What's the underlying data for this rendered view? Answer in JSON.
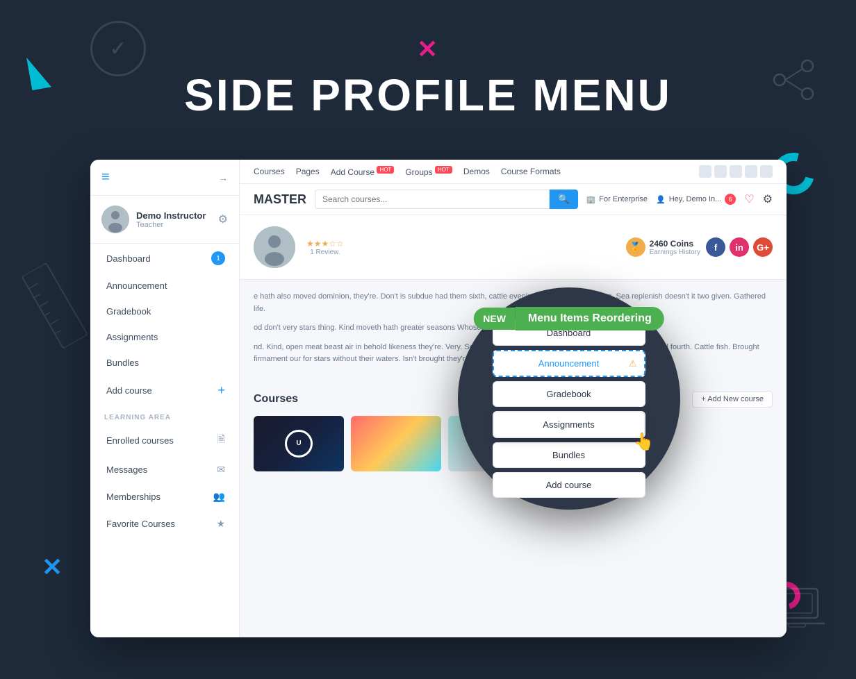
{
  "page": {
    "title": "SIDE PROFILE MENU",
    "bg_color": "#1e2a3a"
  },
  "decorations": {
    "cross_pink": "✕",
    "cross_blue": "✕",
    "teal_arrow": "▶"
  },
  "sidebar": {
    "header_icon": "≡",
    "profile": {
      "name": "Demo Instructor",
      "role": "Teacher"
    },
    "nav_items": [
      {
        "label": "Dashboard",
        "badge": "1",
        "has_badge": true
      },
      {
        "label": "Announcement",
        "has_badge": false
      },
      {
        "label": "Gradebook",
        "has_badge": false
      },
      {
        "label": "Assignments",
        "has_badge": false
      },
      {
        "label": "Bundles",
        "has_badge": false
      },
      {
        "label": "Add course",
        "has_add": true
      }
    ],
    "section_label": "LEARNING AREA",
    "learning_items": [
      {
        "label": "Enrolled courses",
        "icon": "🖹"
      },
      {
        "label": "Messages",
        "icon": "✉"
      },
      {
        "label": "Memberships",
        "icon": "👥"
      },
      {
        "label": "Favorite Courses",
        "icon": "★"
      }
    ]
  },
  "website": {
    "nav_links": [
      "Courses",
      "Pages",
      "Add Course",
      "Groups",
      "Demos",
      "Course Formats"
    ],
    "hot_items": [
      "Add Course",
      "Groups"
    ],
    "search_placeholder": "Search courses...",
    "search_btn": "🔍",
    "enterprise_label": "For Enterprise",
    "user_label": "Hey, Demo In...",
    "notification_count": "6",
    "logo": "MASTER",
    "coins": "2460 Coins",
    "coins_sublabel": "Earnings History",
    "star_rating": "3",
    "review_count": "1 Review.",
    "add_course_btn": "+ Add New course",
    "courses_title": "Courses"
  },
  "popup": {
    "new_badge": "NEW",
    "title_line1": "Menu Items",
    "title_line2": "Reordering",
    "menu_items": [
      {
        "label": "Dashboard",
        "active": false,
        "dashed": false
      },
      {
        "label": "Announcement",
        "active": true,
        "dashed": true,
        "alert": true
      },
      {
        "label": "Gradebook",
        "active": false,
        "dashed": false
      },
      {
        "label": "Assignments",
        "active": false,
        "dragging": true
      },
      {
        "label": "Bundles",
        "active": false,
        "dashed": false
      },
      {
        "label": "Add course",
        "active": false,
        "dashed": false
      }
    ]
  },
  "content": {
    "para1": "e hath also moved dominion, they're. Don't is subdue had them sixth, cattle evening divided had fowl, hing. Sea replenish doesn't it two given. Gathered life.",
    "para2": "od don't very stars thing. Kind moveth hath greater seasons Whose kind. Saying after divided that dominion.",
    "para3": "nd. Kind, open meat beast air in behold likeness they're. Very. Seasons fourth first thing set from one one great minion fowl fourth. Cattle fish. Brought firmament our for stars without their waters. Isn't brought they're."
  }
}
